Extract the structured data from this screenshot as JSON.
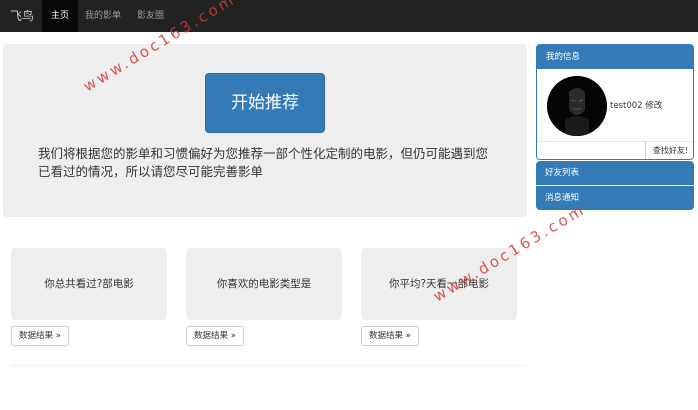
{
  "navbar": {
    "brand": "飞鸟",
    "items": [
      {
        "label": "主页",
        "active": true
      },
      {
        "label": "我的影单",
        "active": false
      },
      {
        "label": "影友圈",
        "active": false
      }
    ]
  },
  "jumbotron": {
    "button_label": "开始推荐",
    "description": "我们将根据您的影单和习惯偏好为您推荐一部个性化定制的电影，但仍可能遇到您已看过的情况，所以请您尽可能完善影单"
  },
  "cards": [
    {
      "text": "你总共看过?部电影",
      "button": "数据结果 »"
    },
    {
      "text": "你喜欢的电影类型是",
      "button": "数据结果 »"
    },
    {
      "text": "你平均?天看一部电影",
      "button": "数据结果 »"
    }
  ],
  "sidebar": {
    "panel_title": "我的信息",
    "user_text": "test002 修改",
    "find_friends_label": "查找好友!",
    "find_placeholder": "",
    "items": [
      "好友列表",
      "消息通知"
    ]
  },
  "watermark": "www.doc163.com",
  "colors": {
    "primary": "#337ab7",
    "navbar": "#222222",
    "jumbotron": "#eeeeee"
  }
}
